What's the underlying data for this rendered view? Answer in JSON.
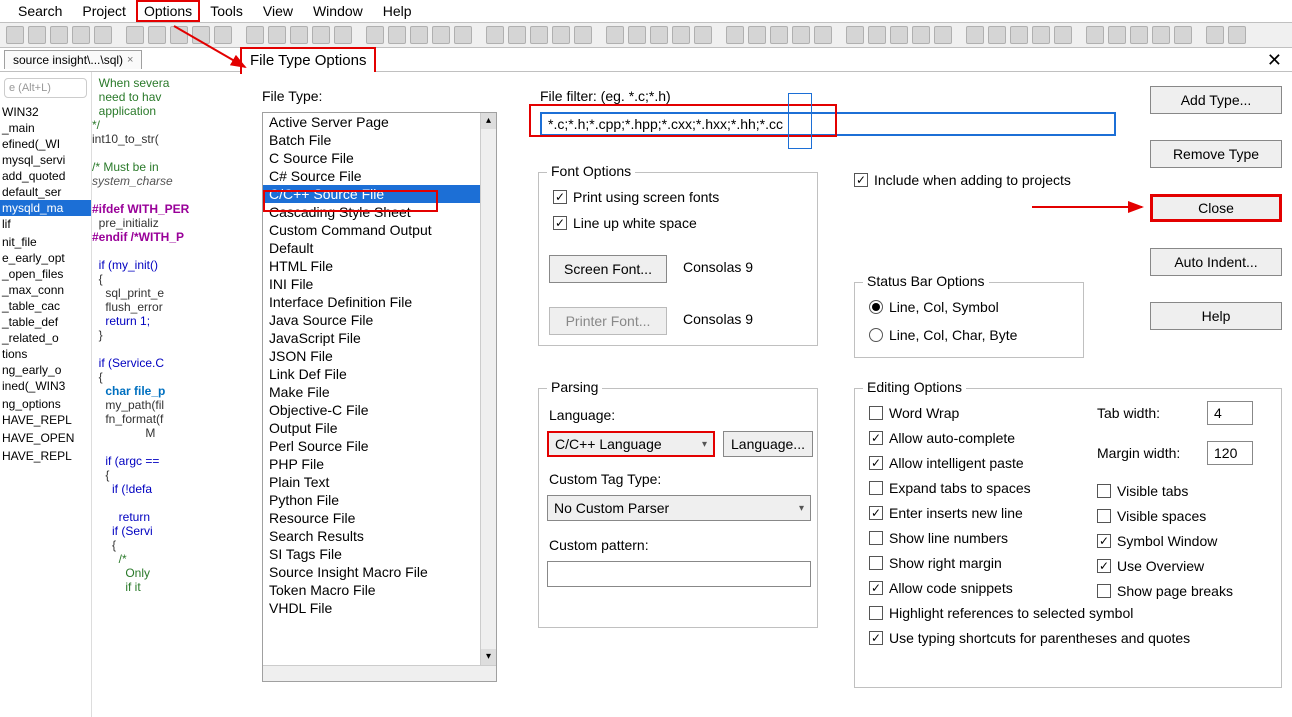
{
  "menu": {
    "items": [
      "Search",
      "Project",
      "Options",
      "Tools",
      "View",
      "Window",
      "Help"
    ],
    "highlight_index": 2
  },
  "tab": {
    "label": "source insight\\...\\sql)",
    "close": "×"
  },
  "dialog_title": "File Type Options",
  "nav": {
    "placeholder": "e (Alt+L)",
    "items": [
      "WIN32",
      "_main",
      "efined(_WI",
      "mysql_servi",
      "add_quoted",
      "default_ser",
      "mysqld_ma",
      "lif",
      "",
      "nit_file",
      "e_early_opt",
      "_open_files",
      "_max_conn",
      "_table_cac",
      "_table_def",
      "_related_o",
      "tions",
      "ng_early_o",
      "ined(_WIN3",
      "",
      "ng_options",
      "HAVE_REPL",
      "",
      "HAVE_OPEN",
      "",
      "HAVE_REPL",
      "",
      " "
    ],
    "selected_index": 6
  },
  "code_lines": [
    {
      "c": "cmt",
      "t": "  When severa"
    },
    {
      "c": "cmt",
      "t": "  need to hav"
    },
    {
      "c": "cmt",
      "t": "  application"
    },
    {
      "c": "cmt",
      "t": "*/"
    },
    {
      "c": "",
      "t": "int10_to_str("
    },
    {
      "c": "",
      "t": " "
    },
    {
      "c": "cmt",
      "t": "/* Must be in"
    },
    {
      "c": "id",
      "t": "system_charse"
    },
    {
      "c": "",
      "t": ""
    },
    {
      "c": "pp",
      "t": "#ifdef WITH_PER"
    },
    {
      "c": "",
      "t": "  pre_initializ"
    },
    {
      "c": "pp",
      "t": "#endif /*WITH_P"
    },
    {
      "c": "",
      "t": ""
    },
    {
      "c": "kw",
      "t": "  if (my_init()"
    },
    {
      "c": "",
      "t": "  {"
    },
    {
      "c": "",
      "t": "    sql_print_e"
    },
    {
      "c": "",
      "t": "    flush_error"
    },
    {
      "c": "kw",
      "t": "    return 1;"
    },
    {
      "c": "",
      "t": "  }"
    },
    {
      "c": "",
      "t": ""
    },
    {
      "c": "kw",
      "t": "  if (Service.C"
    },
    {
      "c": "",
      "t": "  {"
    },
    {
      "c": "typ",
      "t": "    char file_p"
    },
    {
      "c": "",
      "t": "    my_path(fil"
    },
    {
      "c": "",
      "t": "    fn_format(f"
    },
    {
      "c": "",
      "t": "                M"
    },
    {
      "c": "",
      "t": ""
    },
    {
      "c": "kw",
      "t": "    if (argc =="
    },
    {
      "c": "",
      "t": "    {"
    },
    {
      "c": "kw",
      "t": "      if (!defa"
    },
    {
      "c": "",
      "t": ""
    },
    {
      "c": "kw",
      "t": "        return "
    },
    {
      "c": "kw",
      "t": "      if (Servi"
    },
    {
      "c": "",
      "t": "      {"
    },
    {
      "c": "cmt",
      "t": "        /*"
    },
    {
      "c": "cmt",
      "t": "          Only "
    },
    {
      "c": "cmt",
      "t": "          if it"
    }
  ],
  "filetype_label": "File Type:",
  "filetypes": [
    "Active Server Page",
    "Batch File",
    "C Source File",
    "C# Source File",
    "C/C++ Source File",
    "Cascading Style Sheet",
    "Custom Command Output",
    "Default",
    "HTML File",
    "INI File",
    "Interface Definition File",
    "Java Source File",
    "JavaScript File",
    "JSON File",
    "Link Def File",
    "Make File",
    "Objective-C File",
    "Output File",
    "Perl Source File",
    "PHP File",
    "Plain Text",
    "Python File",
    "Resource File",
    "Search Results",
    "SI Tags File",
    "Source Insight Macro File",
    "Token Macro File",
    "VHDL File"
  ],
  "filetype_selected_index": 4,
  "filefilter_label": "File filter: (eg. *.c;*.h)",
  "filefilter_value": "*.c;*.h;*.cpp;*.hpp;*.cxx;*.hxx;*.hh;*.cc",
  "font_options": {
    "title": "Font Options",
    "print_screen": "Print using screen fonts",
    "line_up": "Line up white space",
    "screen_font_btn": "Screen Font...",
    "printer_font_btn": "Printer Font...",
    "font_name": "Consolas 9"
  },
  "include_projects": "Include when adding to projects",
  "status_bar": {
    "title": "Status Bar Options",
    "opt1": "Line, Col, Symbol",
    "opt2": "Line, Col, Char, Byte"
  },
  "parsing": {
    "title": "Parsing",
    "lang_label": "Language:",
    "lang_value": "C/C++ Language",
    "lang_btn": "Language...",
    "tag_label": "Custom Tag Type:",
    "tag_value": "No Custom Parser",
    "pattern_label": "Custom pattern:"
  },
  "editing": {
    "title": "Editing Options",
    "opts": [
      {
        "label": "Word Wrap",
        "checked": false
      },
      {
        "label": "Allow auto-complete",
        "checked": true
      },
      {
        "label": "Allow intelligent paste",
        "checked": true
      },
      {
        "label": "Expand tabs to spaces",
        "checked": false
      },
      {
        "label": "Enter inserts new line",
        "checked": true
      },
      {
        "label": "Show line numbers",
        "checked": false
      },
      {
        "label": "Show right margin",
        "checked": false
      },
      {
        "label": "Allow code snippets",
        "checked": true
      },
      {
        "label": "Highlight references to selected symbol",
        "checked": false
      },
      {
        "label": "Use typing shortcuts for parentheses and quotes",
        "checked": true
      }
    ],
    "tab_width_label": "Tab width:",
    "tab_width": "4",
    "margin_label": "Margin width:",
    "margin": "120",
    "right_opts": [
      {
        "label": "Visible tabs",
        "checked": false
      },
      {
        "label": "Visible spaces",
        "checked": false
      },
      {
        "label": "Symbol Window",
        "checked": true
      },
      {
        "label": "Use Overview",
        "checked": true
      },
      {
        "label": "Show page breaks",
        "checked": false
      }
    ]
  },
  "buttons": {
    "add": "Add Type...",
    "remove": "Remove Type",
    "close": "Close",
    "auto_indent": "Auto Indent...",
    "help": "Help"
  }
}
